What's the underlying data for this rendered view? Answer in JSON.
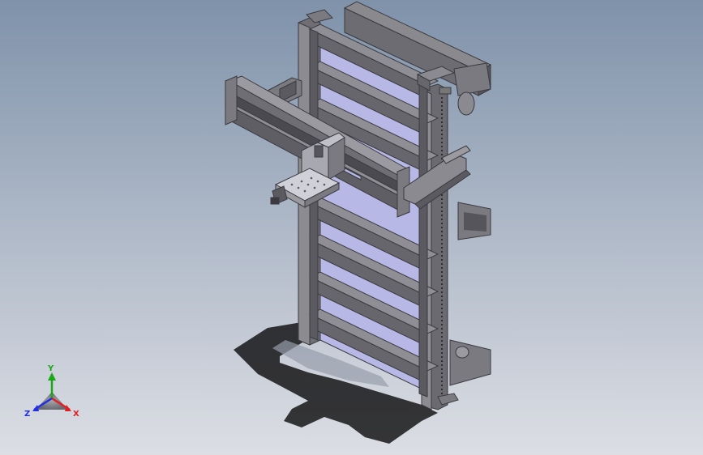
{
  "triad": {
    "x_label": "X",
    "y_label": "Y",
    "z_label": "Z",
    "x_color": "#e02020",
    "y_color": "#18a818",
    "z_color": "#2030e0"
  },
  "colors": {
    "background_top": "#7f92aa",
    "background_bottom": "#dcdee4",
    "steel_light": "#8e8e92",
    "steel_mid": "#6e6e74",
    "steel_dark": "#4a4a50",
    "panel_lavender": "#b8b8e8",
    "shadow": "#1c1c1e"
  },
  "model": {
    "description_icon": "vertical-lift-frame-assembly-icon"
  }
}
